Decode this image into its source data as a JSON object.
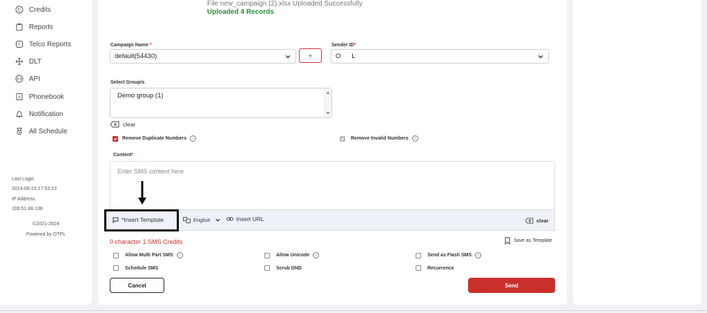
{
  "sidebar": {
    "items": [
      {
        "label": "Credits",
        "icon": "credits-icon"
      },
      {
        "label": "Reports",
        "icon": "clipboard-icon"
      },
      {
        "label": "Telco Reports",
        "icon": "telco-icon"
      },
      {
        "label": "DLT",
        "icon": "move-icon"
      },
      {
        "label": "API",
        "icon": "api-icon"
      },
      {
        "label": "Phonebook",
        "icon": "phonebook-icon"
      },
      {
        "label": "Notification",
        "icon": "bell-icon"
      },
      {
        "label": "All Schedule",
        "icon": "clock-icon"
      }
    ],
    "last_login_label": "Last Login",
    "last_login_value": "2024-09-23 17:53:23",
    "ip_label": "IP Address",
    "ip_value": "106.51.88.138",
    "copyright": "©2021-2024",
    "powered_by": "Powered by OTPL"
  },
  "upload": {
    "file_message": "File new_campaign (2).xlsx Uploaded Successfully",
    "records_message": "Uploaded 4 Records"
  },
  "form": {
    "campaign_label": "Campaign Name",
    "required_mark": "*",
    "campaign_value": "default(54430)",
    "add_campaign_label": "+",
    "sender_label": "Sender ID",
    "sender_value": "O      L",
    "group_label": "Select Group/s",
    "groups": [
      "Demo group (1)"
    ],
    "clear_label": "clear",
    "remove_duplicates_label": "Remove Duplicate Numbers",
    "remove_invalid_label": "Remove Invalid Numbers",
    "content_label": "Content",
    "content_placeholder": "Enter SMS content here",
    "insert_template_label": "*Insert Template",
    "language_value": "English",
    "insert_url_label": "Insert URL",
    "content_clear_label": "clear",
    "credit_info": "0 character 1 SMS Credits",
    "save_template_label": "Save as Template",
    "options": [
      {
        "label": "Allow Multi Part SMS",
        "info": true
      },
      {
        "label": "Allow Unicode",
        "info": true
      },
      {
        "label": "Send as Flash SMS",
        "info": true
      },
      {
        "label": "Schedule SMS",
        "info": false
      },
      {
        "label": "Scrub DND",
        "info": false
      },
      {
        "label": "Recurrence",
        "info": false
      }
    ],
    "cancel_label": "Cancel",
    "send_label": "Send"
  },
  "colors": {
    "accent": "#c9302c",
    "success": "#2e8b3a",
    "error_text": "#d03030"
  }
}
